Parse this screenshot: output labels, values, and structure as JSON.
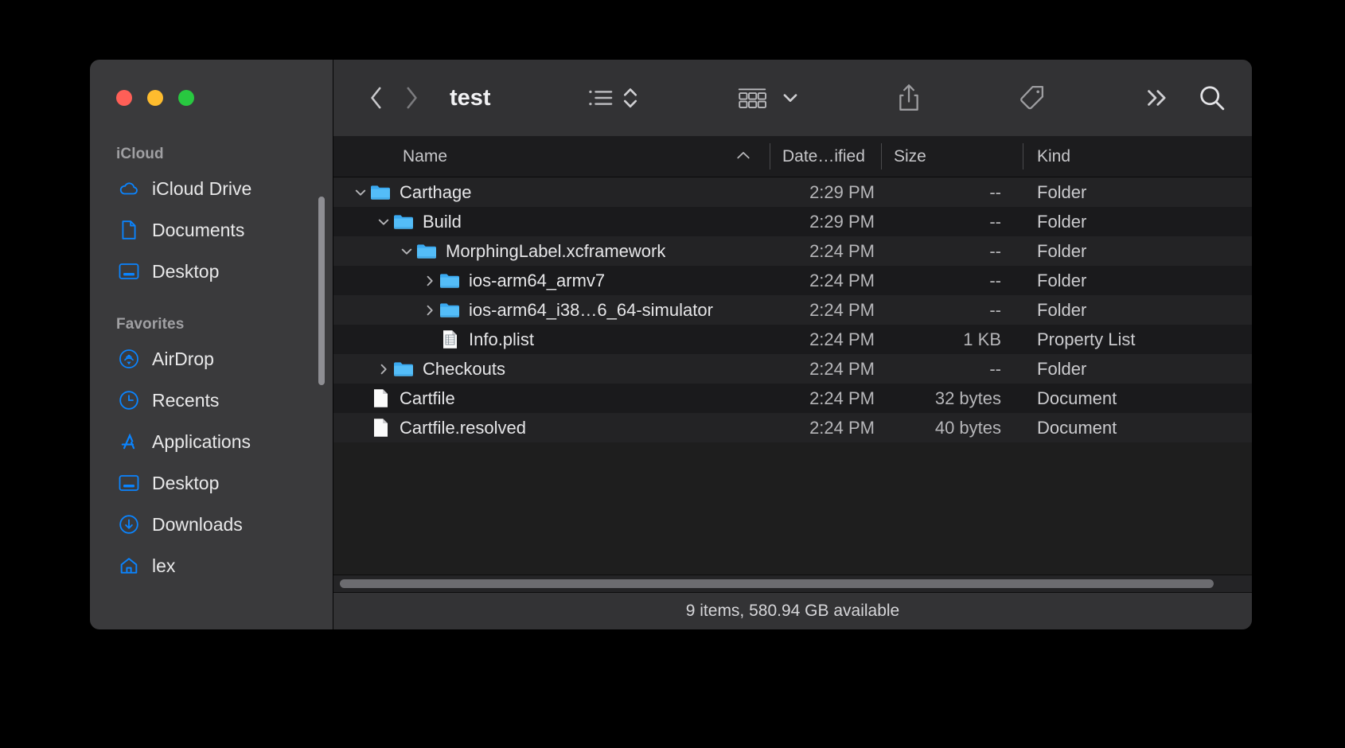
{
  "window": {
    "title": "test",
    "traffic_lights": [
      {
        "name": "close",
        "color": "#ff5f57"
      },
      {
        "name": "minimize",
        "color": "#febc2e"
      },
      {
        "name": "maximize",
        "color": "#28c840"
      }
    ]
  },
  "toolbar": {
    "back_icon": "chevron-left-icon",
    "forward_icon": "chevron-right-icon",
    "title": "test",
    "list_view_icon": "list-view-icon",
    "sort_icon": "sort-updown-icon",
    "group_icon": "group-items-icon",
    "group_chevron_icon": "chevron-down-icon",
    "share_icon": "share-icon",
    "tag_icon": "tag-icon",
    "more_icon": "more-chevrons-icon",
    "search_icon": "search-icon"
  },
  "sidebar": {
    "sections": [
      {
        "title": "iCloud",
        "items": [
          {
            "label": "iCloud Drive",
            "icon": "cloud-icon"
          },
          {
            "label": "Documents",
            "icon": "document-icon"
          },
          {
            "label": "Desktop",
            "icon": "desktop-icon"
          }
        ]
      },
      {
        "title": "Favorites",
        "items": [
          {
            "label": "AirDrop",
            "icon": "airdrop-icon"
          },
          {
            "label": "Recents",
            "icon": "clock-icon"
          },
          {
            "label": "Applications",
            "icon": "applications-icon"
          },
          {
            "label": "Desktop",
            "icon": "desktop-icon"
          },
          {
            "label": "Downloads",
            "icon": "download-circle-icon"
          },
          {
            "label": "lex",
            "icon": "home-icon"
          }
        ]
      }
    ]
  },
  "columns": {
    "name": "Name",
    "sort_caret": "⌃",
    "date": "Date…ified",
    "size": "Size",
    "kind": "Kind"
  },
  "files": [
    {
      "name": "Carthage",
      "depth": 0,
      "twisty": "down",
      "icon": "folder-icon",
      "date": "2:29 PM",
      "size": "--",
      "kind": "Folder"
    },
    {
      "name": "Build",
      "depth": 1,
      "twisty": "down",
      "icon": "folder-icon",
      "date": "2:29 PM",
      "size": "--",
      "kind": "Folder"
    },
    {
      "name": "MorphingLabel.xcframework",
      "depth": 2,
      "twisty": "down",
      "icon": "folder-icon",
      "date": "2:24 PM",
      "size": "--",
      "kind": "Folder"
    },
    {
      "name": "ios-arm64_armv7",
      "depth": 3,
      "twisty": "right",
      "icon": "folder-icon",
      "date": "2:24 PM",
      "size": "--",
      "kind": "Folder"
    },
    {
      "name": "ios-arm64_i38…6_64-simulator",
      "depth": 3,
      "twisty": "right",
      "icon": "folder-icon",
      "date": "2:24 PM",
      "size": "--",
      "kind": "Folder"
    },
    {
      "name": "Info.plist",
      "depth": 3,
      "twisty": "none",
      "icon": "plist-icon",
      "date": "2:24 PM",
      "size": "1 KB",
      "kind": "Property List"
    },
    {
      "name": "Checkouts",
      "depth": 1,
      "twisty": "right",
      "icon": "folder-icon",
      "date": "2:24 PM",
      "size": "--",
      "kind": "Folder"
    },
    {
      "name": "Cartfile",
      "depth": 0,
      "twisty": "none",
      "icon": "doc-icon",
      "date": "2:24 PM",
      "size": "32 bytes",
      "kind": "Document"
    },
    {
      "name": "Cartfile.resolved",
      "depth": 0,
      "twisty": "none",
      "icon": "doc-icon",
      "date": "2:24 PM",
      "size": "40 bytes",
      "kind": "Document"
    }
  ],
  "statusbar": {
    "text": "9 items, 580.94 GB available"
  },
  "colors": {
    "accent": "#0a84ff",
    "folder": "#54bdf8",
    "window_sidebar": "#3a3a3c",
    "window_main": "#1e1e1e",
    "toolbar": "#323234"
  }
}
